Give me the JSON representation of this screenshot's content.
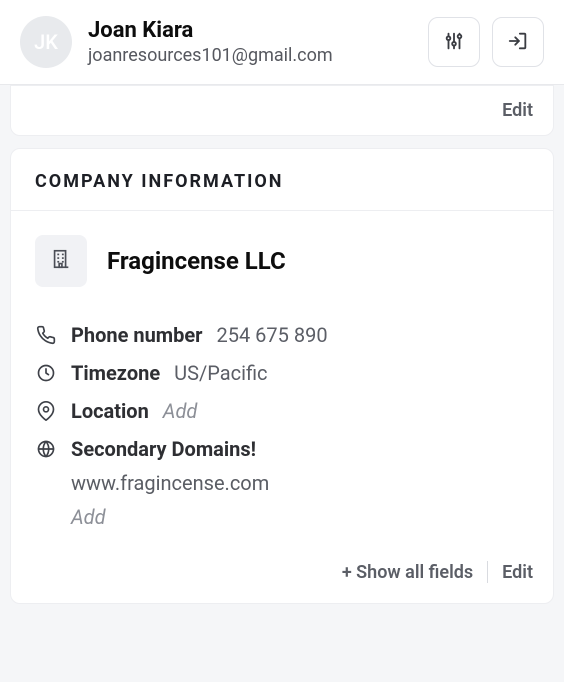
{
  "header": {
    "avatar_initials": "JK",
    "user_name": "Joan Kiara",
    "user_email": "joanresources101@gmail.com"
  },
  "top_card": {
    "edit_label": "Edit"
  },
  "company_card": {
    "title": "COMPANY INFORMATION",
    "company_name": "Fragincense LLC",
    "fields": {
      "phone": {
        "label": "Phone number",
        "value": "254 675 890"
      },
      "timezone": {
        "label": "Timezone",
        "value": "US/Pacific"
      },
      "location": {
        "label": "Location",
        "add": "Add"
      },
      "domains": {
        "label": "Secondary Domains!",
        "value": "www.fragincense.com",
        "add": "Add"
      }
    },
    "footer": {
      "show_all": "+ Show all fields",
      "edit": "Edit"
    }
  }
}
